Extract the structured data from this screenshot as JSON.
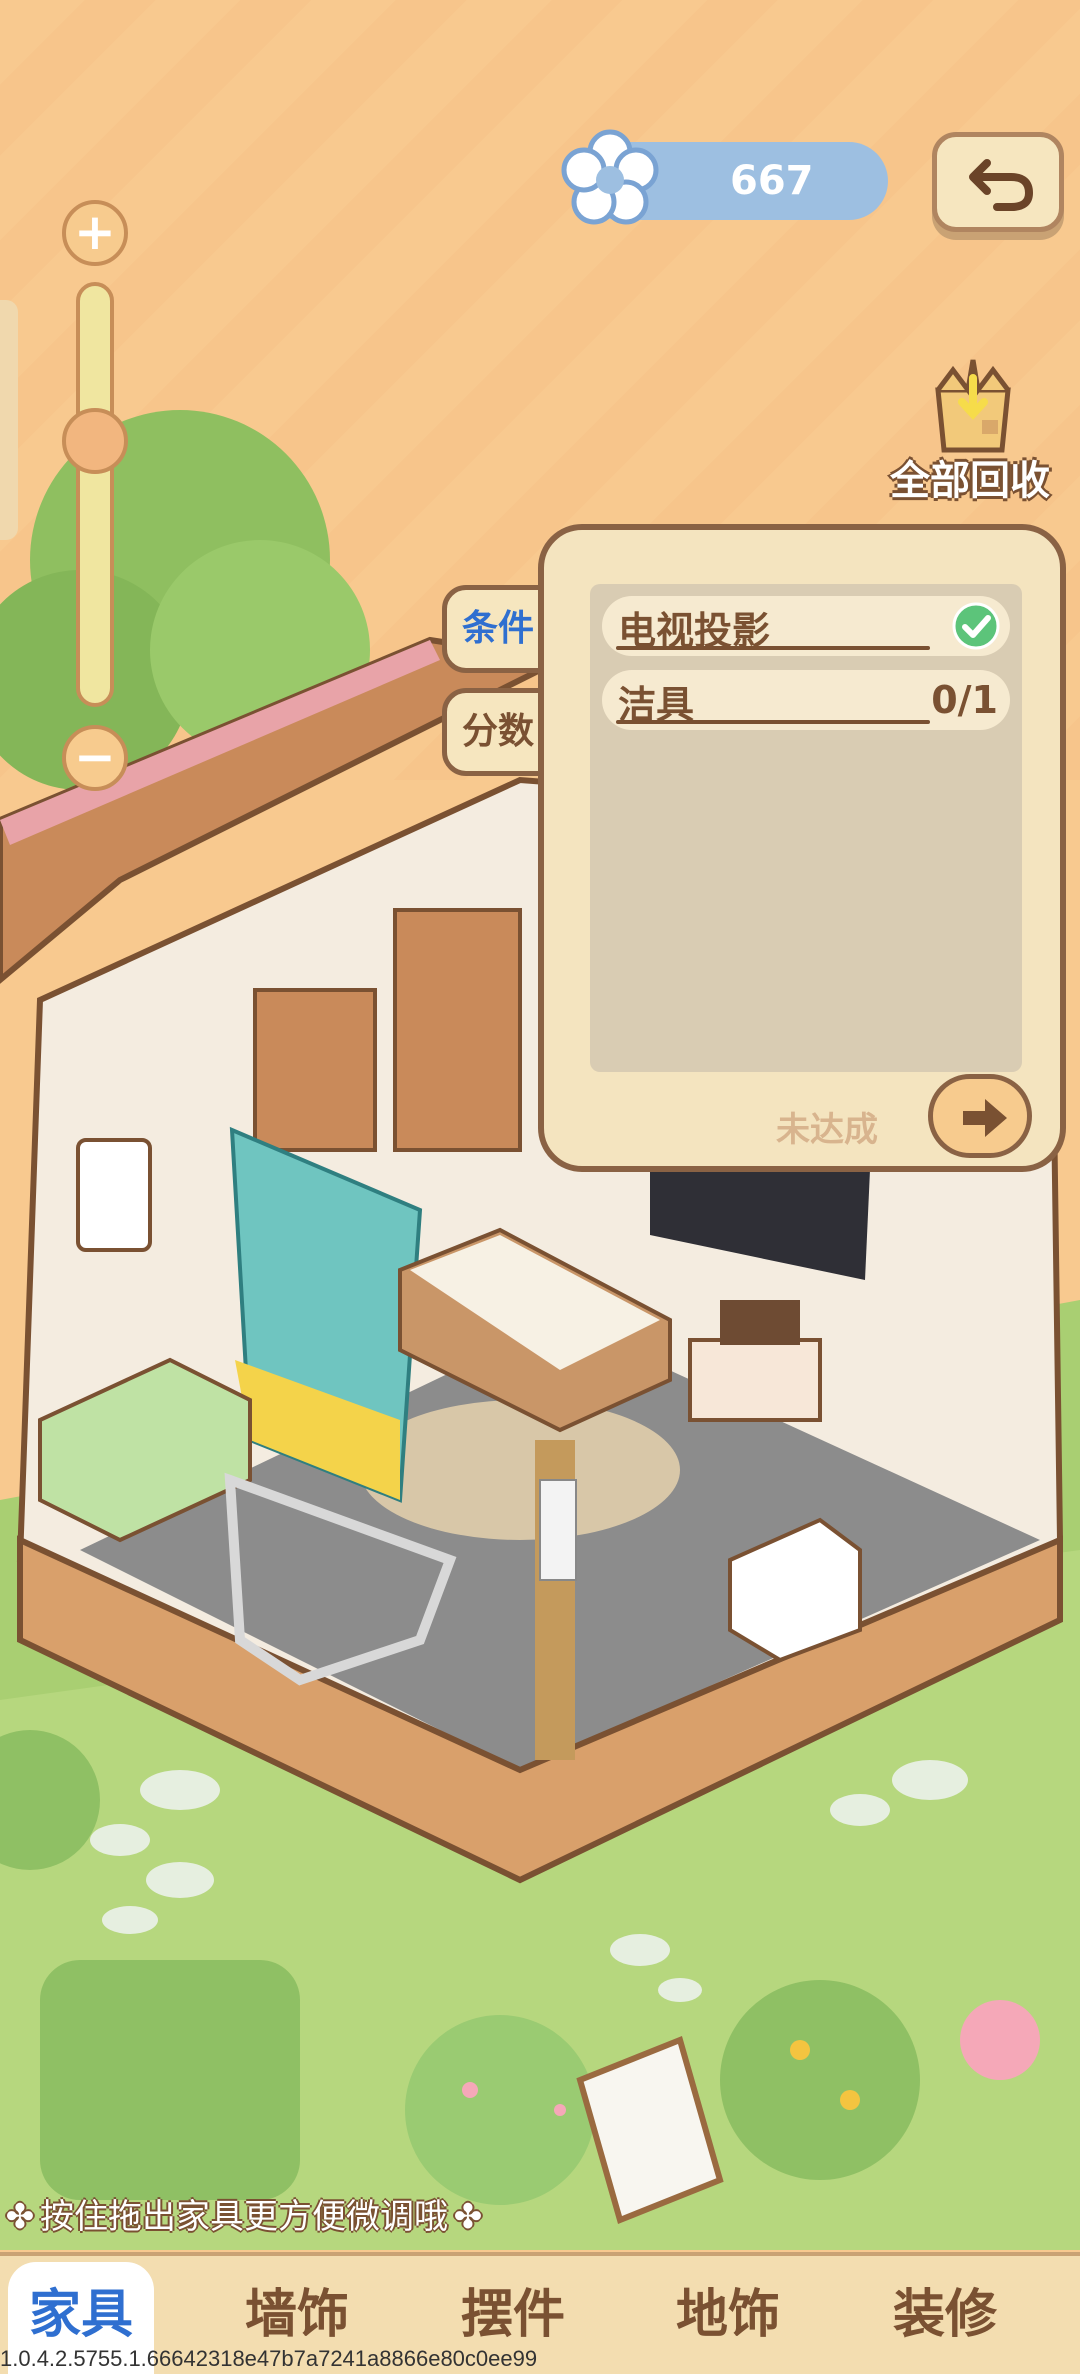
{
  "currency": {
    "value": "667",
    "icon": "flower-icon"
  },
  "zoom": {
    "plus_label": "+",
    "minus_label": "−",
    "level": 0.65
  },
  "recycle": {
    "label": "全部回收",
    "icon": "box-icon"
  },
  "side_tabs": {
    "conditions": "条件",
    "score": "分数"
  },
  "conditions": {
    "items": [
      {
        "label": "电视投影",
        "status": "done",
        "progress": ""
      },
      {
        "label": "洁具",
        "status": "pending",
        "progress": "0/1"
      }
    ],
    "status_text": "未达成"
  },
  "hint": {
    "text": "按住拖出家具更方便微调哦"
  },
  "nav": {
    "items": [
      {
        "label": "家具"
      },
      {
        "label": "墙饰"
      },
      {
        "label": "摆件"
      },
      {
        "label": "地饰"
      },
      {
        "label": "装修"
      }
    ]
  },
  "build_id": "1.0.4.2.5755.1.66642318e47b7a7241a8866e80c0ee99"
}
